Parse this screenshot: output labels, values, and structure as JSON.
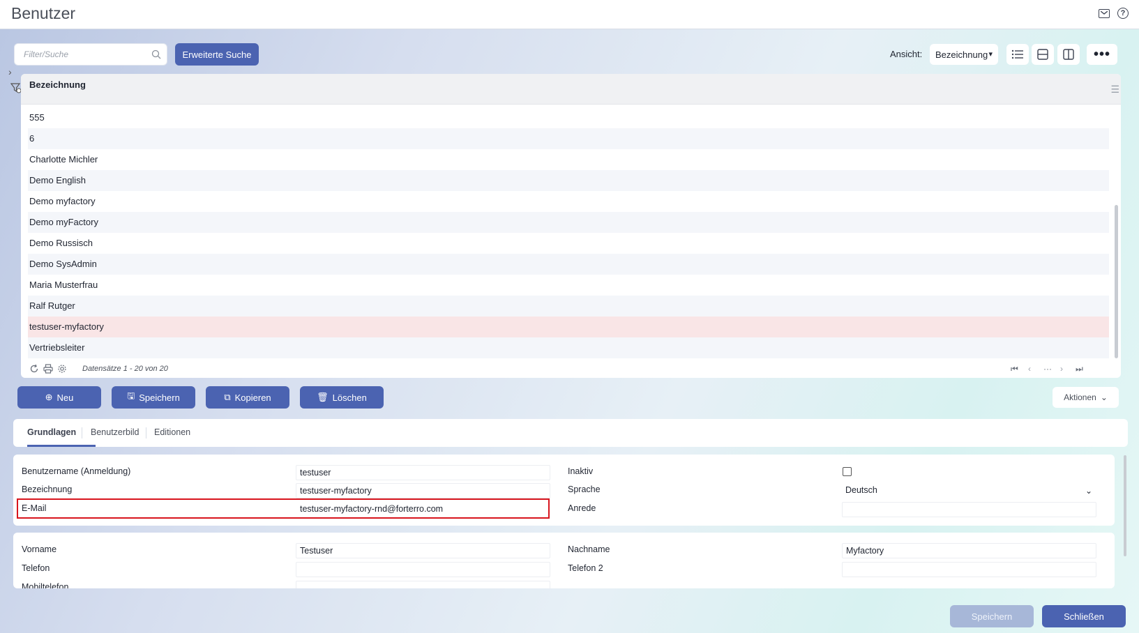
{
  "window": {
    "title": "Benutzer"
  },
  "header_icons": {
    "mail": "mail-icon",
    "help": "help-icon"
  },
  "toolbar": {
    "search_placeholder": "Filter/Suche",
    "advanced_search_label": "Erweiterte Suche",
    "view_label": "Ansicht:",
    "view_selected": "Bezeichnung",
    "more_label": "•••"
  },
  "grid": {
    "column_header": "Bezeichnung",
    "rows": [
      "555",
      "6",
      "Charlotte Michler",
      "Demo English",
      "Demo myfactory",
      "Demo myFactory",
      "Demo Russisch",
      "Demo SysAdmin",
      "Maria Musterfrau",
      "Ralf Rutger",
      "testuser-myfactory",
      "Vertriebsleiter"
    ],
    "selected_row": "testuser-myfactory",
    "records_text": "Datensätze 1 - 20 von 20"
  },
  "actions": {
    "new_label": "Neu",
    "save_label": "Speichern",
    "copy_label": "Kopieren",
    "delete_label": "Löschen",
    "aktionen_label": "Aktionen"
  },
  "tabs": [
    {
      "label": "Grundlagen",
      "active": true
    },
    {
      "label": "Benutzerbild",
      "active": false
    },
    {
      "label": "Editionen",
      "active": false
    }
  ],
  "form": {
    "username_label": "Benutzername (Anmeldung)",
    "username_value": "testuser",
    "bezeichnung_label": "Bezeichnung",
    "bezeichnung_value": "testuser-myfactory",
    "email_label": "E-Mail",
    "email_value": "testuser-myfactory-rnd@forterro.com",
    "inaktiv_label": "Inaktiv",
    "sprache_label": "Sprache",
    "sprache_value": "Deutsch",
    "anrede_label": "Anrede",
    "anrede_value": "",
    "vorname_label": "Vorname",
    "vorname_value": "Testuser",
    "nachname_label": "Nachname",
    "nachname_value": "Myfactory",
    "telefon_label": "Telefon",
    "telefon_value": "",
    "telefon2_label": "Telefon 2",
    "telefon2_value": "",
    "mobil_label": "Mobiltelefon",
    "mobil_value": ""
  },
  "footer": {
    "save_label": "Speichern",
    "close_label": "Schließen"
  },
  "colors": {
    "primary": "#4b63b1",
    "primary_disabled": "#a7b7d8",
    "selected_row": "#f9e5e6",
    "highlight": "#d8151d"
  }
}
